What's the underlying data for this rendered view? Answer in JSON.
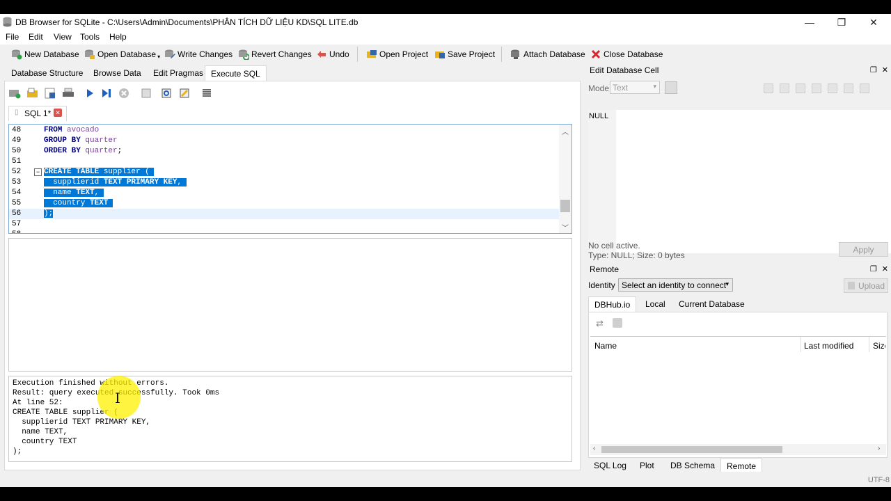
{
  "window": {
    "title": "DB Browser for SQLite - C:\\Users\\Admin\\Documents\\PHÂN TÍCH DỮ LIỆU KD\\SQL LITE.db",
    "minimize": "—",
    "restore": "❐",
    "close": "✕"
  },
  "menu": [
    "File",
    "Edit",
    "View",
    "Tools",
    "Help"
  ],
  "toolbar": {
    "new_database": "New Database",
    "open_database": "Open Database",
    "write_changes": "Write Changes",
    "revert_changes": "Revert Changes",
    "undo": "Undo",
    "open_project": "Open Project",
    "save_project": "Save Project",
    "attach_database": "Attach Database",
    "close_database": "Close Database"
  },
  "main_tabs": [
    "Database Structure",
    "Browse Data",
    "Edit Pragmas",
    "Execute SQL"
  ],
  "sql_tab": {
    "label": "SQL 1*",
    "close": "✕"
  },
  "editor": {
    "lines": [
      {
        "n": "48",
        "t": "FROM avocado"
      },
      {
        "n": "49",
        "t": "GROUP BY quarter"
      },
      {
        "n": "50",
        "t": "ORDER BY quarter;"
      },
      {
        "n": "51",
        "t": ""
      },
      {
        "n": "52",
        "t": "CREATE TABLE supplier ("
      },
      {
        "n": "53",
        "t": "  supplierid TEXT PRIMARY KEY,"
      },
      {
        "n": "54",
        "t": "  name TEXT,"
      },
      {
        "n": "55",
        "t": "  country TEXT"
      },
      {
        "n": "56",
        "t": ");"
      },
      {
        "n": "57",
        "t": ""
      },
      {
        "n": "58",
        "t": ""
      }
    ]
  },
  "messages": "Execution finished without errors.\nResult: query executed successfully. Took 0ms\nAt line 52:\nCREATE TABLE supplier (\n  supplierid TEXT PRIMARY KEY,\n  name TEXT,\n  country TEXT\n);",
  "edit_cell": {
    "title": "Edit Database Cell",
    "mode_label": "Mode:",
    "mode_value": "Text",
    "value": "NULL",
    "status1": "No cell active.",
    "status2": "Type: NULL; Size: 0 bytes",
    "apply": "Apply"
  },
  "remote": {
    "title": "Remote",
    "identity_label": "Identity",
    "identity_value": "Select an identity to connect",
    "upload": "Upload",
    "tabs": [
      "DBHub.io",
      "Local",
      "Current Database"
    ],
    "columns": [
      "Name",
      "Last modified",
      "Size"
    ]
  },
  "bottom_tabs": [
    "SQL Log",
    "Plot",
    "DB Schema",
    "Remote"
  ],
  "status": {
    "encoding": "UTF-8"
  },
  "colors": {
    "selection": "#0078d7",
    "keyword": "#000080",
    "identifier": "#7b3f9e"
  }
}
